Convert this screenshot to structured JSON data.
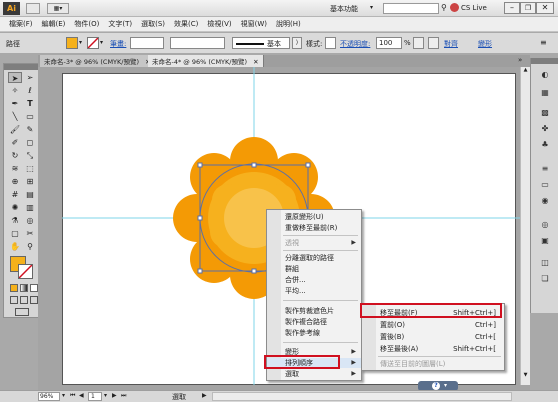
{
  "app_bar": {
    "logo": "Ai",
    "workspace": "基本功能",
    "cs_live": "CS Live"
  },
  "menu": [
    "檔案(F)",
    "編輯(E)",
    "物件(O)",
    "文字(T)",
    "選取(S)",
    "效果(C)",
    "檢視(V)",
    "視窗(W)",
    "說明(H)"
  ],
  "control": {
    "path_label": "路徑",
    "stroke_label": "筆畫:",
    "stroke_basic": "基本",
    "style_label": "樣式:",
    "opacity_label": "不透明度:",
    "opacity_value": "100",
    "opacity_unit": "%",
    "align": "對齊",
    "transform": "變形"
  },
  "tabs": [
    {
      "label": "未命名-3* @ 96% (CMYK/預覽)"
    },
    {
      "label": "未命名-4* @ 96% (CMYK/預覽)"
    }
  ],
  "context_menu": {
    "items": [
      {
        "label": "還原變形(U)"
      },
      {
        "label": "重做移至最前(R)"
      },
      {
        "label": "透視",
        "disabled": true
      },
      {
        "label": "分離選取的路徑"
      },
      {
        "label": "群組"
      },
      {
        "label": "合併..."
      },
      {
        "label": "平均..."
      },
      {
        "label": "製作剪裁遮色片"
      },
      {
        "label": "製作複合路徑"
      },
      {
        "label": "製作參考線"
      },
      {
        "label": "變形"
      },
      {
        "label": "排列順序"
      },
      {
        "label": "選取"
      }
    ]
  },
  "submenu": {
    "items": [
      {
        "label": "移至最前(F)",
        "shortcut": "Shift+Ctrl+]"
      },
      {
        "label": "置前(O)",
        "shortcut": "Ctrl+]"
      },
      {
        "label": "置後(B)",
        "shortcut": "Ctrl+["
      },
      {
        "label": "移至最後(A)",
        "shortcut": "Shift+Ctrl+["
      },
      {
        "label": "傳送至目前的圖層(L)",
        "disabled": true
      }
    ]
  },
  "status": {
    "zoom": "96%",
    "page": "1",
    "tool": "選取"
  },
  "colors": {
    "fill": "#f5b11b",
    "shape_outer": "#f49a05",
    "shape_mid": "#f6b11e",
    "shape_inner": "#f8c24a",
    "guide": "#7fd6ea",
    "highlight": "#d01020"
  },
  "icons": [
    "selection-tool-icon",
    "direct-selection-icon",
    "pen-icon",
    "type-icon",
    "line-icon",
    "rectangle-icon",
    "brush-icon",
    "pencil-icon",
    "rotate-icon",
    "scale-icon",
    "warp-icon",
    "free-transform-icon",
    "symbol-sprayer-icon",
    "graph-icon",
    "mesh-icon",
    "gradient-icon",
    "eyedropper-icon",
    "blend-icon",
    "live-paint-icon",
    "scissors-icon",
    "hand-icon",
    "zoom-icon"
  ]
}
